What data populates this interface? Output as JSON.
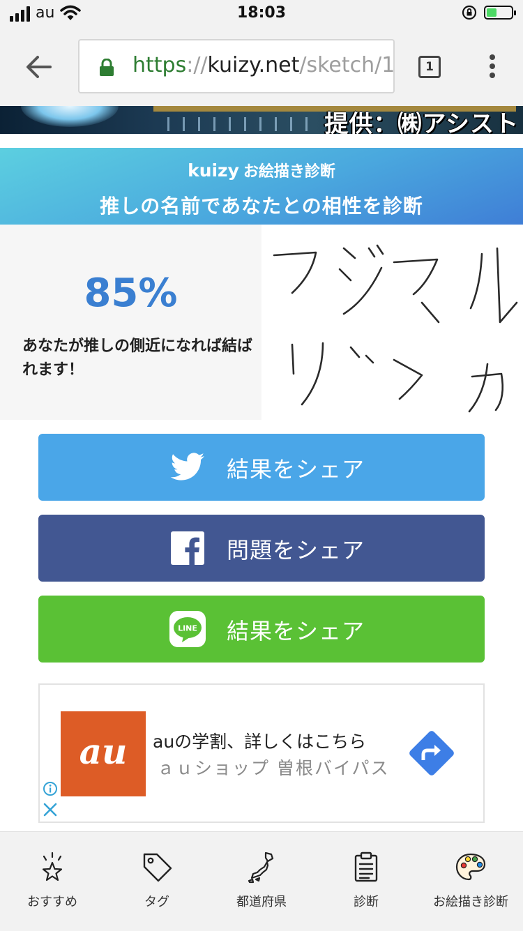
{
  "status_bar": {
    "carrier": "au",
    "time": "18:03",
    "battery_color": "#4cd964"
  },
  "browser": {
    "url_scheme": "https",
    "url_sep": "://",
    "url_host": "kuizy.net",
    "url_path": "/sketch/1",
    "tab_count": "1",
    "back_icon": "back-arrow-icon",
    "lock_icon": "lock-icon",
    "menu_icon": "more-vert-icon"
  },
  "banner": {
    "text": "提供：㈱アシスト"
  },
  "header": {
    "brand_name": "kuizy",
    "brand_suffix": "お絵描き診断",
    "title": "推しの名前であなたとの相性を診断",
    "gradient_colors": [
      "#5ccfe0",
      "#4aa8de",
      "#3f7ed6"
    ]
  },
  "result": {
    "percent": "85%",
    "message": "あなたが推しの側近になれば結ばれます！",
    "accent_color": "#3a7fd1",
    "handwriting": "フジマルリツカ"
  },
  "share": {
    "twitter_label": "結果をシェア",
    "facebook_label": "問題をシェア",
    "line_label": "結果をシェア",
    "line_icon_text": "LINE",
    "colors": {
      "twitter": "#4aa6e8",
      "facebook": "#425792",
      "line": "#5ac135"
    }
  },
  "ad": {
    "logo_text": "au",
    "title": "auの学割、詳しくはこちら",
    "subtitle": "ａｕショップ 曽根バイパス",
    "logo_color": "#dd5c26",
    "direction_color": "#3d7ee6"
  },
  "bottom_nav": {
    "items": [
      {
        "label": "おすすめ",
        "icon": "star-sparkle-icon"
      },
      {
        "label": "タグ",
        "icon": "tag-icon"
      },
      {
        "label": "都道府県",
        "icon": "japan-map-icon"
      },
      {
        "label": "診断",
        "icon": "clipboard-icon"
      },
      {
        "label": "お絵描き診断",
        "icon": "palette-icon"
      }
    ]
  }
}
